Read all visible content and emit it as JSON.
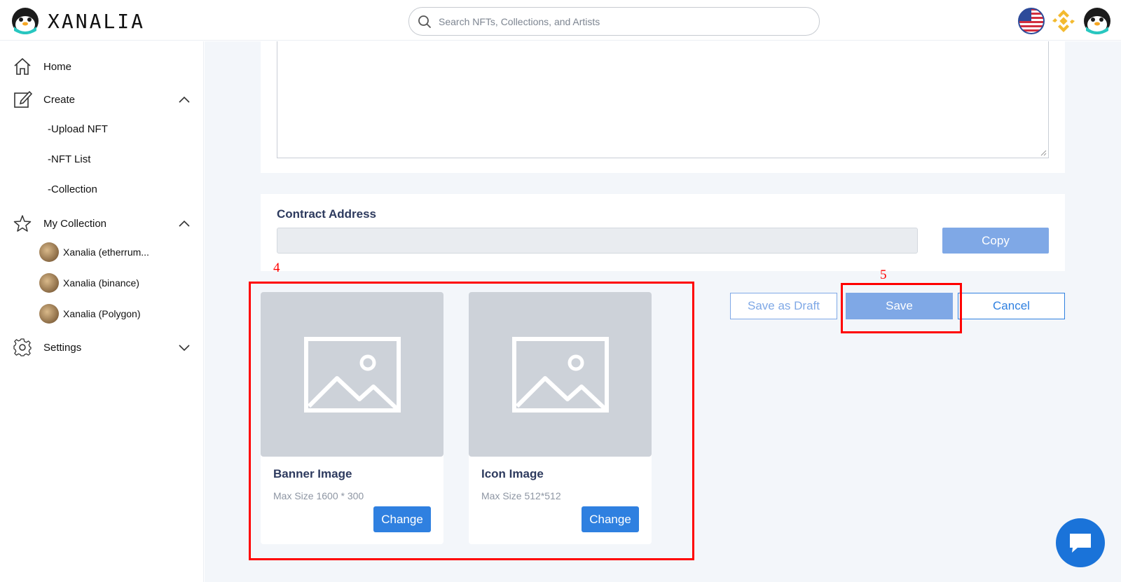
{
  "header": {
    "brand": "XANALIA",
    "search_placeholder": "Search NFTs, Collections, and Artists",
    "icons": [
      "logo-penguin-icon",
      "search-icon",
      "us-flag-icon",
      "binance-icon",
      "avatar-penguin-icon"
    ]
  },
  "sidebar": {
    "home": "Home",
    "create": "Create",
    "create_items": [
      "-Upload NFT",
      "-NFT List",
      "-Collection"
    ],
    "my_collection": "My Collection",
    "collections": [
      "Xanalia (etherrum...",
      "Xanalia (binance)",
      "Xanalia (Polygon)"
    ],
    "settings": "Settings"
  },
  "main": {
    "contract_label": "Contract Address",
    "contract_value": "",
    "copy_label": "Copy",
    "banner": {
      "title": "Banner Image",
      "subtitle": "Max Size 1600 * 300",
      "button": "Change"
    },
    "icon": {
      "title": "Icon Image",
      "subtitle": "Max Size 512*512",
      "button": "Change"
    },
    "save_draft_label": "Save as Draft",
    "save_label": "Save",
    "cancel_label": "Cancel"
  },
  "annotations": {
    "box4": "4",
    "box5": "5"
  },
  "colors": {
    "accent": "#2f80e0",
    "accent_light": "#7fa8e6",
    "annotation": "#ff0000",
    "binance": "#f3ba2f"
  }
}
